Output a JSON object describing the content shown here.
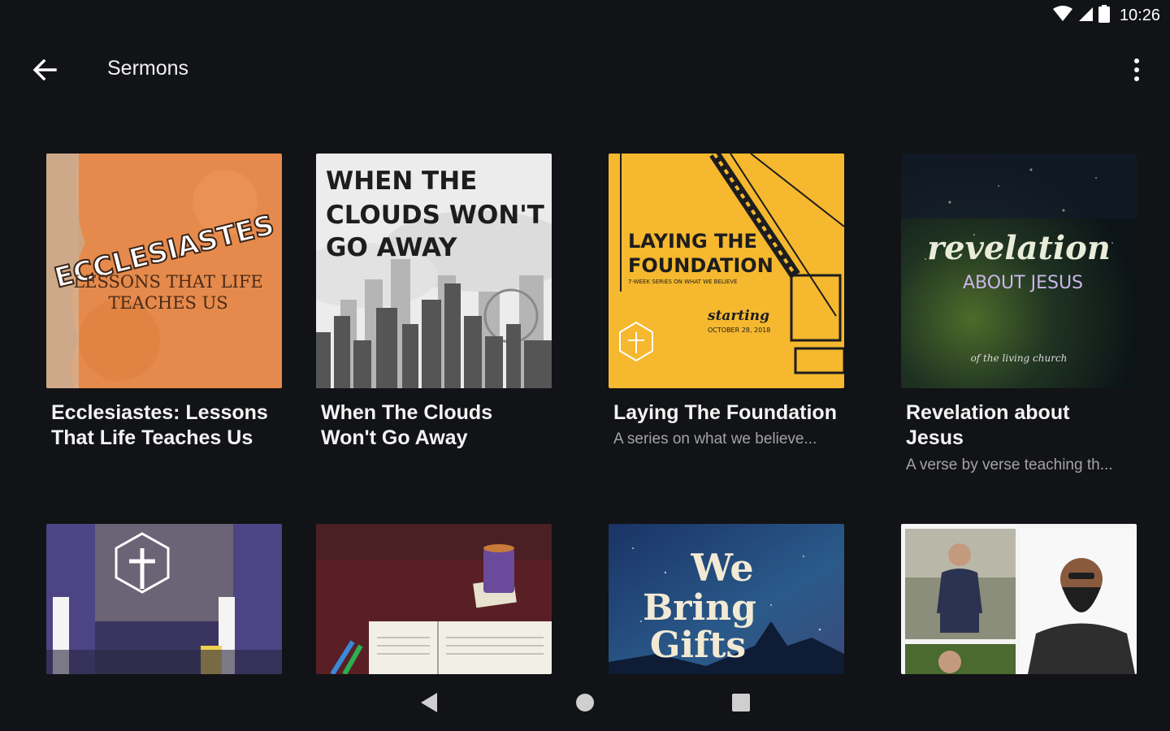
{
  "status_bar": {
    "time": "10:26",
    "icons": [
      "wifi-icon",
      "cell-signal-icon",
      "battery-icon"
    ]
  },
  "app_bar": {
    "title": "Sermons",
    "back_icon": "arrow-back-icon",
    "menu_icon": "more-vert-icon"
  },
  "series": [
    {
      "title_line1": "Ecclesiastes: Lessons",
      "title_line2": "That Life Teaches Us",
      "subtitle": "",
      "artwork": {
        "title": "ECCLESIASTES",
        "subtitle_line1": "LESSONS THAT LIFE",
        "subtitle_line2": "TEACHES US",
        "bg_color": "#e58a4c"
      }
    },
    {
      "title_line1": "When The Clouds",
      "title_line2": "Won't Go Away",
      "subtitle": "",
      "artwork": {
        "line1": "WHEN THE",
        "line2": "CLOUDS WON'T",
        "line3": "GO AWAY",
        "bg_color": "#ececec"
      }
    },
    {
      "title_line1": "Laying The Foundation",
      "title_line2": "",
      "subtitle": "A series on what we believe...",
      "artwork": {
        "line1": "LAYING THE",
        "line2": "FOUNDATION",
        "tagline": "7-WEEK SERIES ON WHAT WE BELIEVE",
        "starting": "starting",
        "date": "OCTOBER 28, 2018",
        "bg_color": "#f5b82e"
      }
    },
    {
      "title_line1": "Revelation about",
      "title_line2": "Jesus",
      "subtitle": "A verse by verse teaching th...",
      "artwork": {
        "script": "revelation",
        "line2": "ABOUT JESUS",
        "caption": "of the living church",
        "bg_color": "#15211a"
      }
    },
    {
      "artwork": {
        "bg_color": "#3a3560"
      }
    },
    {
      "artwork": {
        "bg_color": "#3a1a1c"
      }
    },
    {
      "artwork": {
        "line1": "We",
        "line2": "Bring",
        "line3": "Gifts",
        "bg_color": "#1f3a66"
      }
    },
    {
      "artwork": {
        "bg_color": "#f4f4f4"
      }
    }
  ],
  "nav_bar": {
    "icons": [
      "nav-back-icon",
      "nav-home-icon",
      "nav-recents-icon"
    ]
  },
  "colors": {
    "background": "#121316",
    "text_primary": "#f3f3f3",
    "text_secondary": "#a3a3a3"
  }
}
